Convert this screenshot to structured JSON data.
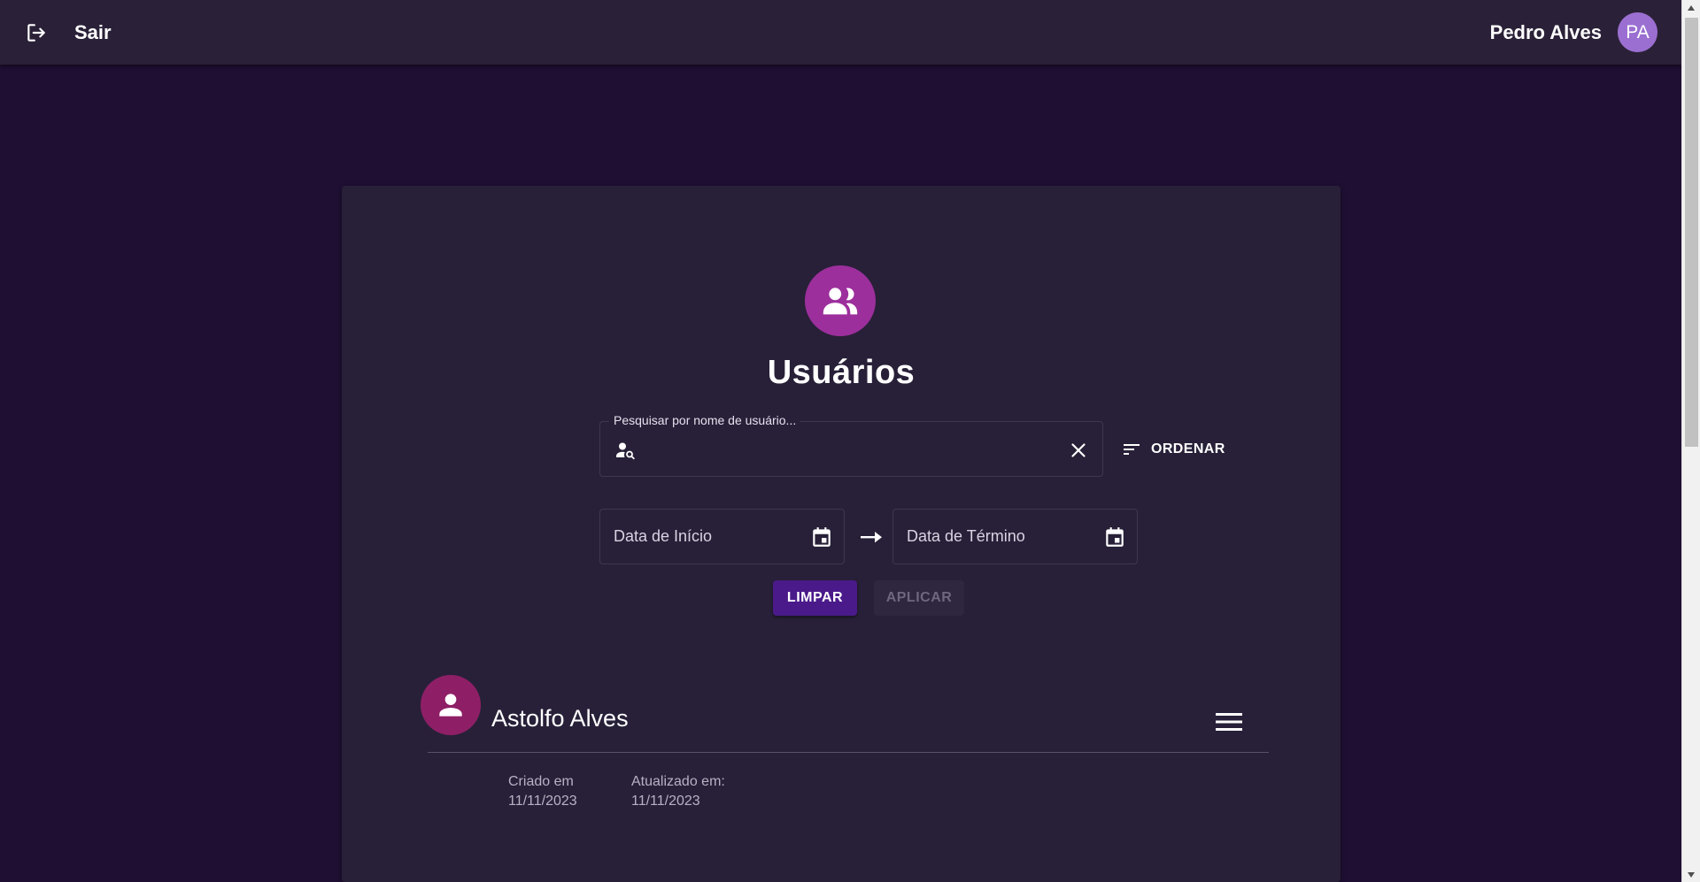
{
  "appbar": {
    "logout_label": "Sair",
    "user_name": "Pedro Alves",
    "avatar_initials": "PA"
  },
  "page": {
    "title": "Usuários"
  },
  "search": {
    "label": "Pesquisar por nome de usuário...",
    "value": ""
  },
  "sort": {
    "label": "ORDENAR"
  },
  "dates": {
    "start_placeholder": "Data de Início",
    "end_placeholder": "Data de Término"
  },
  "actions": {
    "clear_label": "LIMPAR",
    "apply_label": "APLICAR"
  },
  "users": [
    {
      "name": "Astolfo Alves",
      "created_label": "Criado em",
      "created_date": "11/11/2023",
      "updated_label": "Atualizado em:",
      "updated_date": "11/11/2023"
    }
  ],
  "colors": {
    "background": "#1e0f33",
    "appbar": "#2a2138",
    "card": "#282038",
    "hero_icon": "#9c2f9c",
    "user_avatar": "#8e1f66",
    "avatar_badge": "#9b6fd1",
    "primary_button": "#4a1a8a"
  },
  "icons": {
    "logout": "logout-icon",
    "group": "group-icon",
    "person_search": "person-search-icon",
    "clear": "close-icon",
    "sort": "sort-icon",
    "calendar": "calendar-icon",
    "arrow": "arrow-right-icon",
    "person": "person-icon",
    "menu": "menu-icon"
  }
}
